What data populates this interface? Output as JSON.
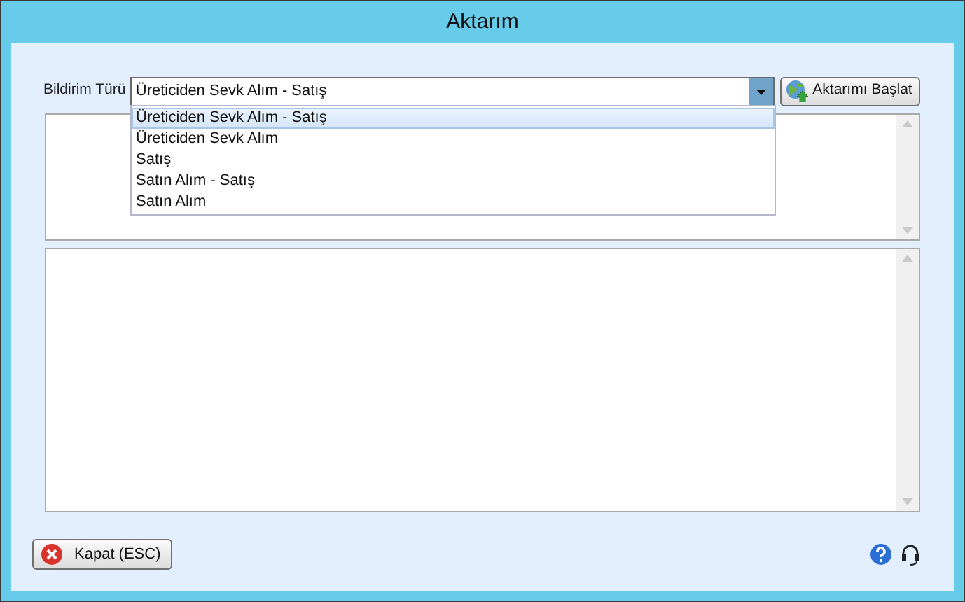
{
  "window": {
    "title": "Aktarım"
  },
  "form": {
    "label": "Bildirim Türü",
    "combo": {
      "value": "Üreticiden Sevk Alım - Satış",
      "expanded": true
    },
    "options": [
      {
        "label": "Üreticiden Sevk Alım - Satış",
        "selected": true
      },
      {
        "label": "Üreticiden Sevk Alım",
        "selected": false
      },
      {
        "label": "Satış",
        "selected": false
      },
      {
        "label": "Satın Alım - Satış",
        "selected": false
      },
      {
        "label": "Satın Alım",
        "selected": false
      }
    ],
    "start_button": "Aktarımı Başlat"
  },
  "close_button": "Kapat (ESC)"
}
